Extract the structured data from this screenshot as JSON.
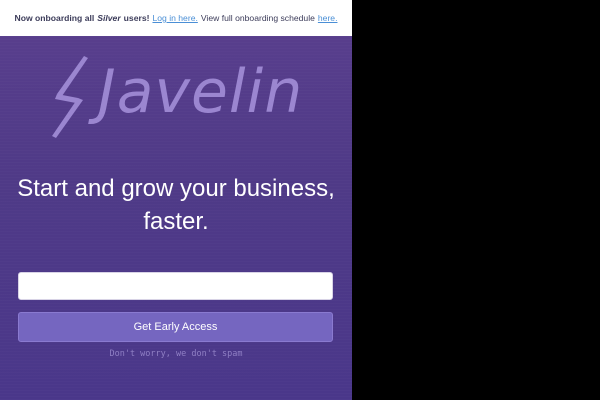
{
  "banner": {
    "prefix": "Now onboarding all",
    "tier": "Silver",
    "suffix": "users!",
    "login_link": "Log in here.",
    "schedule_text": "View full onboarding schedule",
    "schedule_link": "here."
  },
  "logo": {
    "icon": "lightning-bolt-icon",
    "text": "Javelin",
    "color": "#9b86d0"
  },
  "hero": {
    "headline_line1": "Start and grow your business,",
    "headline_line2": "faster."
  },
  "signup": {
    "email_value": "",
    "email_placeholder": "",
    "button_label": "Get Early Access",
    "note": "Don't worry, we don't spam"
  },
  "colors": {
    "background": "#4f3a87",
    "button": "#7566c0",
    "link": "#4a8fd6"
  }
}
